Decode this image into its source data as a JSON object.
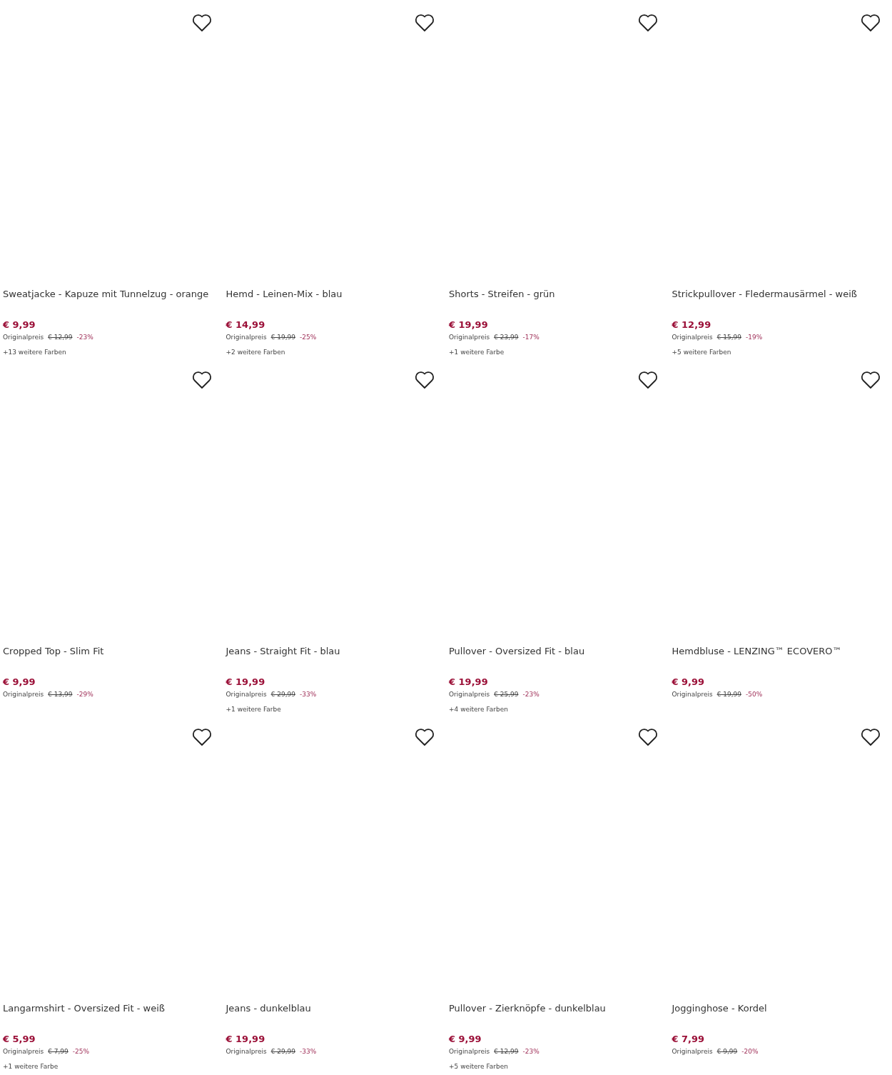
{
  "products": [
    {
      "title": "Sweatjacke - Kapuze mit Tunnelzug - orange",
      "price": "€ 9,99",
      "original_label": "Originalpreis",
      "original_price": "€ 12,99",
      "discount": "-23%",
      "colors": "+13 weitere Farben"
    },
    {
      "title": "Hemd - Leinen-Mix - blau",
      "price": "€ 14,99",
      "original_label": "Originalpreis",
      "original_price": "€ 19,99",
      "discount": "-25%",
      "colors": "+2 weitere Farben"
    },
    {
      "title": "Shorts - Streifen - grün",
      "price": "€ 19,99",
      "original_label": "Originalpreis",
      "original_price": "€ 23,99",
      "discount": "-17%",
      "colors": "+1 weitere Farbe"
    },
    {
      "title": "Strickpullover - Fledermausärmel - weiß",
      "price": "€ 12,99",
      "original_label": "Originalpreis",
      "original_price": "€ 15,99",
      "discount": "-19%",
      "colors": "+5 weitere Farben"
    },
    {
      "title": "Cropped Top - Slim Fit",
      "price": "€ 9,99",
      "original_label": "Originalpreis",
      "original_price": "€ 13,99",
      "discount": "-29%"
    },
    {
      "title": "Jeans - Straight Fit - blau",
      "price": "€ 19,99",
      "original_label": "Originalpreis",
      "original_price": "€ 29,99",
      "discount": "-33%",
      "colors": "+1 weitere Farbe"
    },
    {
      "title": "Pullover - Oversized Fit - blau",
      "price": "€ 19,99",
      "original_label": "Originalpreis",
      "original_price": "€ 25,99",
      "discount": "-23%",
      "colors": "+4 weitere Farben"
    },
    {
      "title": "Hemdbluse - LENZING™ ECOVERO™",
      "price": "€ 9,99",
      "original_label": "Originalpreis",
      "original_price": "€ 19,99",
      "discount": "-50%"
    },
    {
      "title": "Langarmshirt - Oversized Fit - weiß",
      "price": "€ 5,99",
      "original_label": "Originalpreis",
      "original_price": "€ 7,99",
      "discount": "-25%",
      "colors": "+1 weitere Farbe"
    },
    {
      "title": "Jeans - dunkelblau",
      "price": "€ 19,99",
      "original_label": "Originalpreis",
      "original_price": "€ 29,99",
      "discount": "-33%"
    },
    {
      "title": "Pullover - Zierknöpfe - dunkelblau",
      "price": "€ 9,99",
      "original_label": "Originalpreis",
      "original_price": "€ 12,99",
      "discount": "-23%",
      "colors": "+5 weitere Farben"
    },
    {
      "title": "Jogginghose - Kordel",
      "price": "€ 7,99",
      "original_label": "Originalpreis",
      "original_price": "€ 9,99",
      "discount": "-20%"
    }
  ]
}
